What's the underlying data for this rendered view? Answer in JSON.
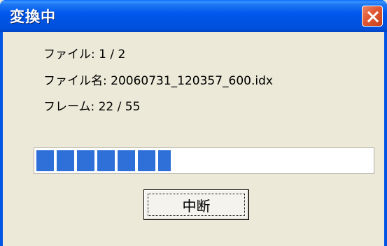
{
  "window": {
    "title": "変換中",
    "close_icon": "close-icon"
  },
  "info": {
    "file": "ファイル: 1 / 2",
    "file_name": "ファイル名: 20060731_120357_600.idx",
    "frame": "フレーム: 22 / 55"
  },
  "progress": {
    "fraction": 0.4
  },
  "buttons": {
    "cancel_label": "中断"
  },
  "colors": {
    "title_bar": "#0055e5",
    "progress_fill": "#2f6fd8",
    "dialog_bg": "#ece9d8",
    "close_button": "#e25b36"
  }
}
